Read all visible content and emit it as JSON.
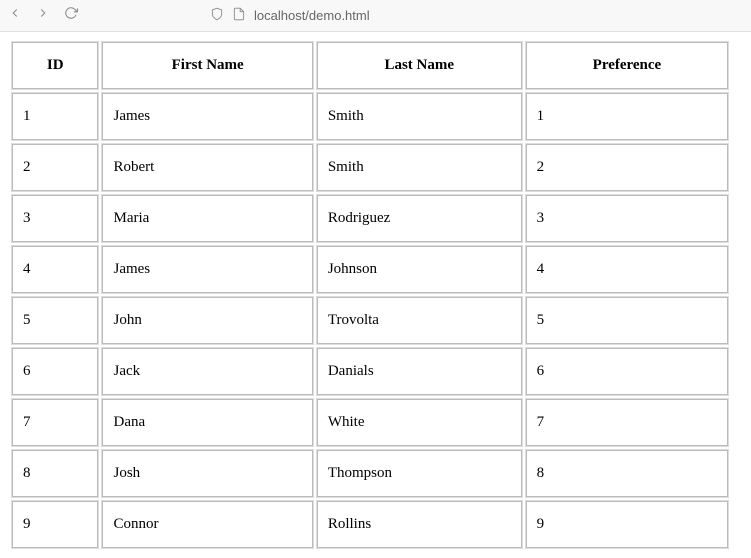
{
  "browser": {
    "url": "localhost/demo.html"
  },
  "table": {
    "headers": [
      "ID",
      "First Name",
      "Last Name",
      "Preference"
    ],
    "rows": [
      {
        "id": "1",
        "first_name": "James",
        "last_name": "Smith",
        "preference": "1"
      },
      {
        "id": "2",
        "first_name": "Robert",
        "last_name": "Smith",
        "preference": "2"
      },
      {
        "id": "3",
        "first_name": "Maria",
        "last_name": "Rodriguez",
        "preference": "3"
      },
      {
        "id": "4",
        "first_name": "James",
        "last_name": "Johnson",
        "preference": "4"
      },
      {
        "id": "5",
        "first_name": "John",
        "last_name": "Trovolta",
        "preference": "5"
      },
      {
        "id": "6",
        "first_name": "Jack",
        "last_name": "Danials",
        "preference": "6"
      },
      {
        "id": "7",
        "first_name": "Dana",
        "last_name": "White",
        "preference": "7"
      },
      {
        "id": "8",
        "first_name": "Josh",
        "last_name": "Thompson",
        "preference": "8"
      },
      {
        "id": "9",
        "first_name": "Connor",
        "last_name": "Rollins",
        "preference": "9"
      }
    ]
  }
}
